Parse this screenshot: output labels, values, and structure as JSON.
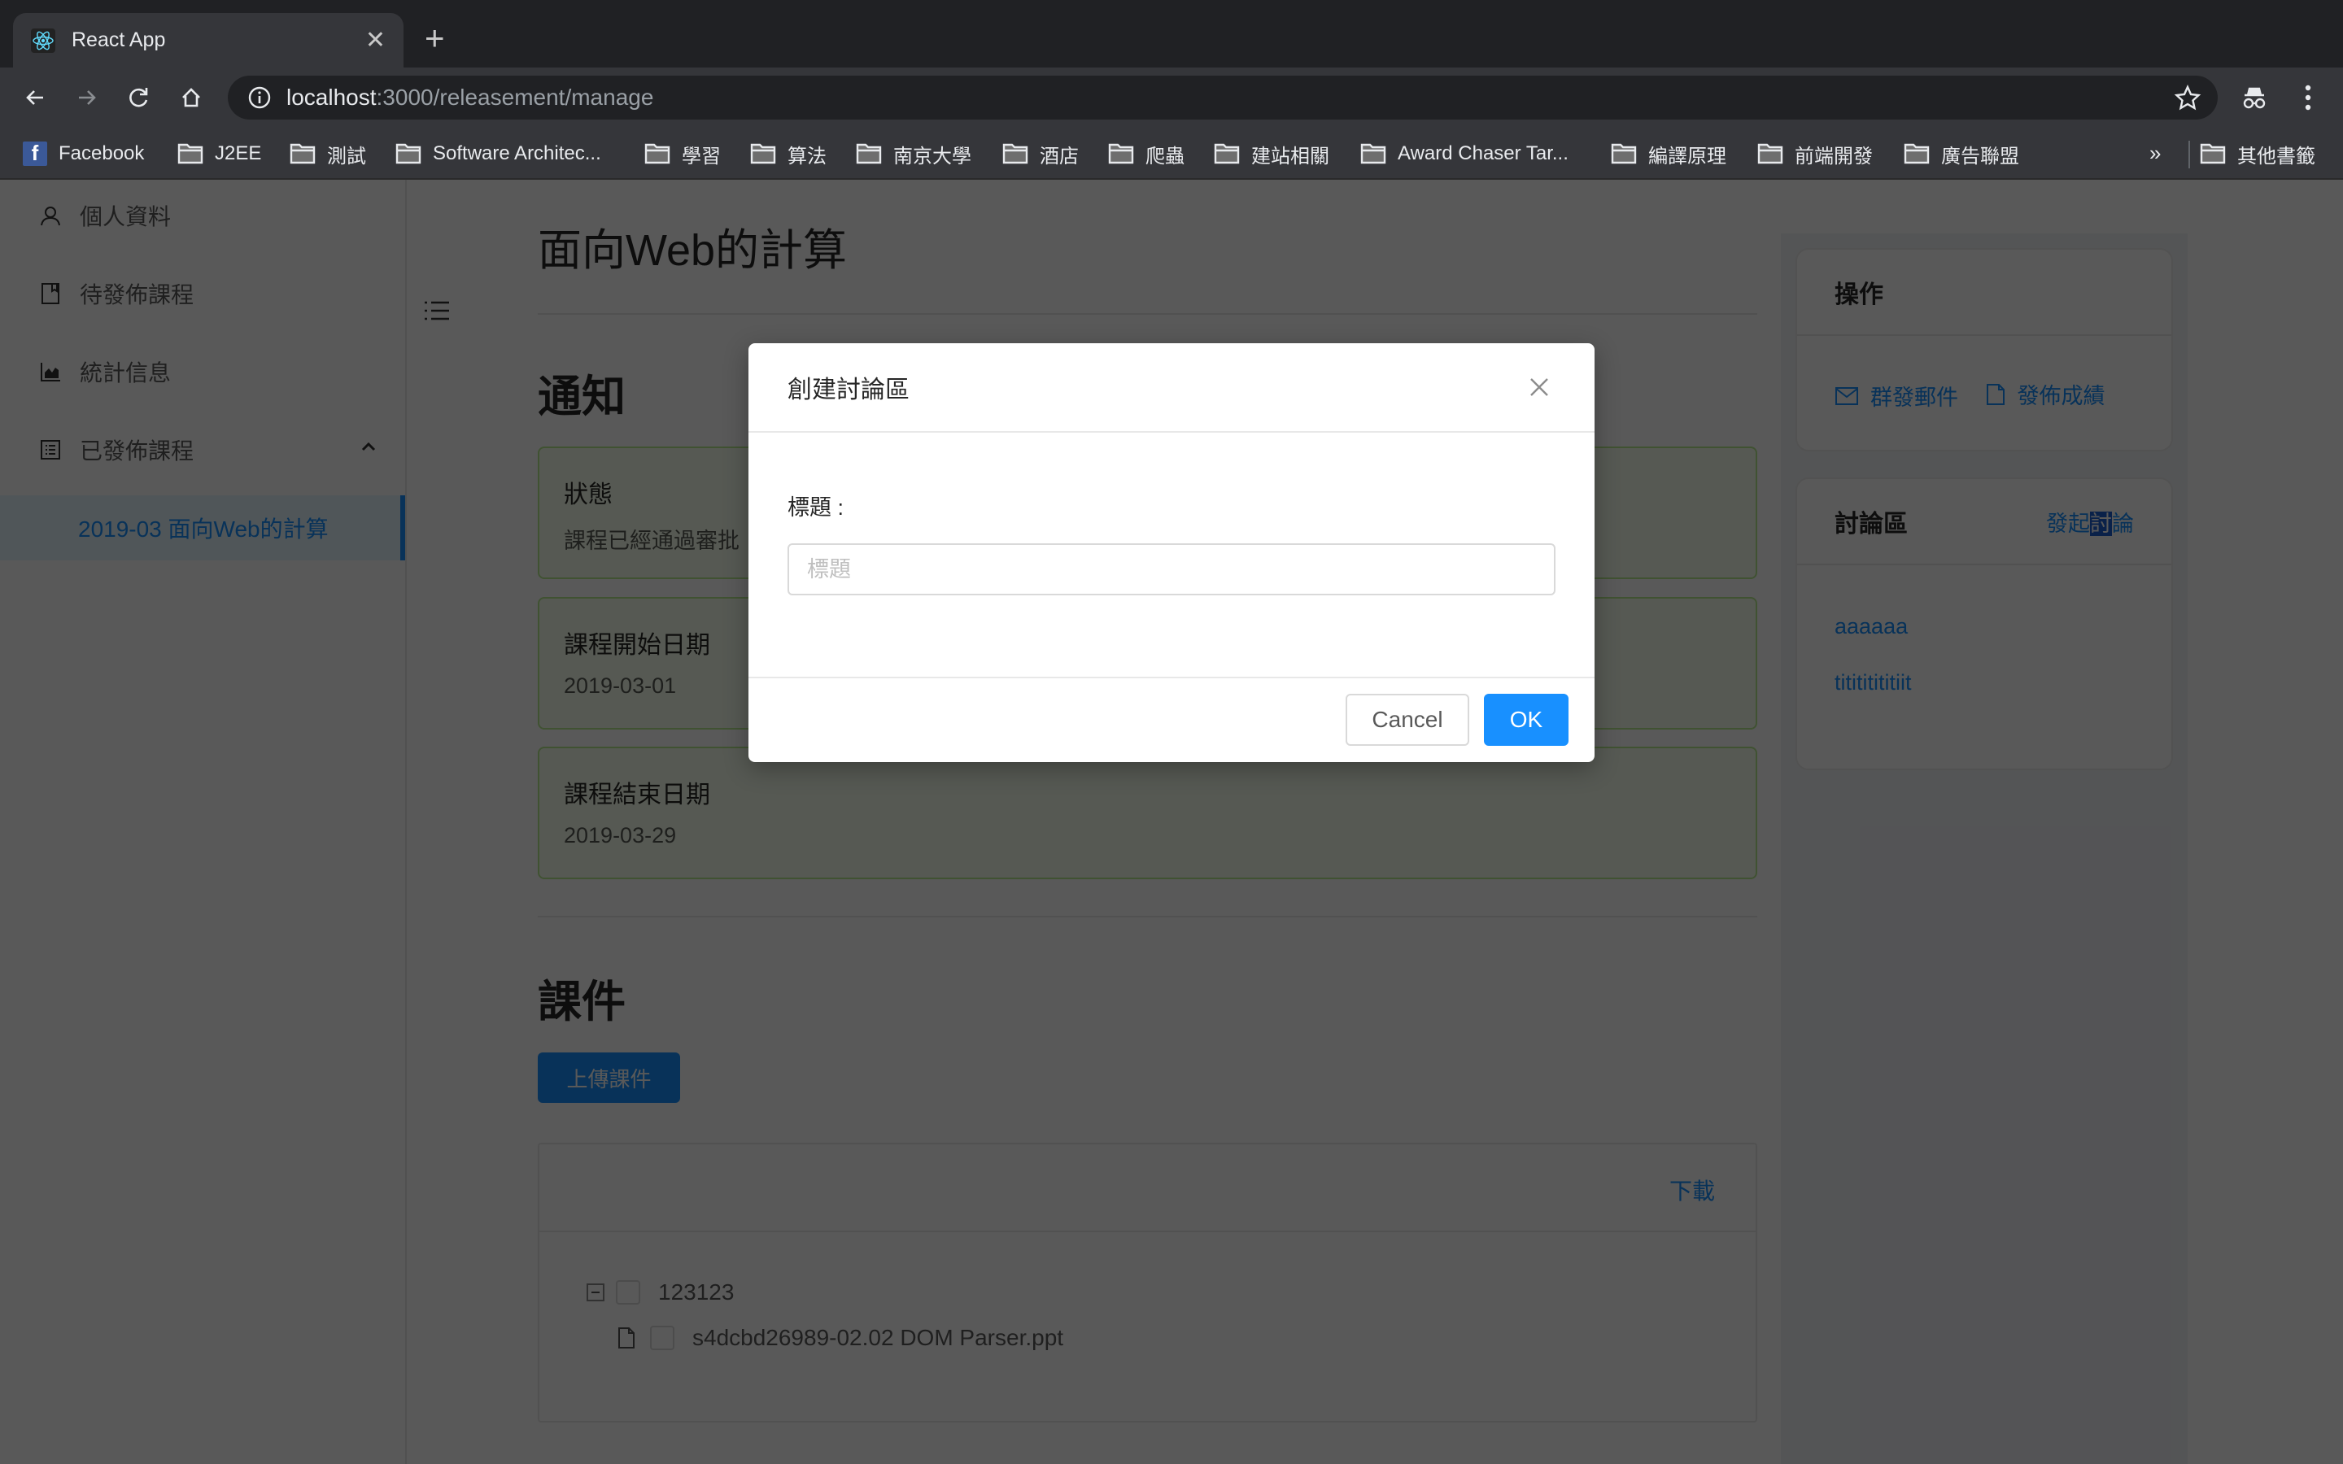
{
  "browser": {
    "tab_title": "React App",
    "url_host": "localhost",
    "url_path": ":3000/releasement/manage",
    "bookmarks": [
      {
        "label": "Facebook",
        "icon": "facebook-icon"
      },
      {
        "label": "J2EE",
        "icon": "folder-icon"
      },
      {
        "label": "測試",
        "icon": "folder-icon"
      },
      {
        "label": "Software Architec...",
        "icon": "folder-icon"
      },
      {
        "label": "學習",
        "icon": "folder-icon"
      },
      {
        "label": "算法",
        "icon": "folder-icon"
      },
      {
        "label": "南京大學",
        "icon": "folder-icon"
      },
      {
        "label": "酒店",
        "icon": "folder-icon"
      },
      {
        "label": "爬蟲",
        "icon": "folder-icon"
      },
      {
        "label": "建站相關",
        "icon": "folder-icon"
      },
      {
        "label": "Award Chaser Tar...",
        "icon": "folder-icon"
      },
      {
        "label": "編譯原理",
        "icon": "folder-icon"
      },
      {
        "label": "前端開發",
        "icon": "folder-icon"
      },
      {
        "label": "廣告聯盟",
        "icon": "folder-icon"
      }
    ],
    "bookmarks_overflow": "»",
    "other_bookmarks": "其他書籤"
  },
  "sidebar": {
    "items": [
      {
        "label": "個人資料",
        "icon": "user-icon"
      },
      {
        "label": "待發佈課程",
        "icon": "book-icon"
      },
      {
        "label": "統計信息",
        "icon": "area-chart-icon"
      },
      {
        "label": "已發佈課程",
        "icon": "profile-icon",
        "expanded": true
      }
    ],
    "sub_items": [
      {
        "label": "2019-03 面向Web的計算",
        "selected": true
      }
    ]
  },
  "main": {
    "title": "面向Web的計算",
    "notice_section": "通知",
    "alerts": [
      {
        "title": "狀態",
        "desc": "課程已經通過審批"
      },
      {
        "title": "課程開始日期",
        "desc": "2019-03-01"
      },
      {
        "title": "課程結束日期",
        "desc": "2019-03-29"
      }
    ],
    "courseware_section": "課件",
    "upload_button": "上傳課件",
    "download_link": "下載",
    "tree": {
      "folder": "123123",
      "file": "s4dcbd26989-02.02 DOM Parser.ppt"
    }
  },
  "right": {
    "actions_title": "操作",
    "actions": [
      {
        "label": "群發郵件",
        "icon": "mail-icon"
      },
      {
        "label": "發佈成績",
        "icon": "file-icon"
      }
    ],
    "discussion_title": "討論區",
    "discussion_extra_parts": [
      "發起",
      "討",
      "論"
    ],
    "discussions": [
      "aaaaaa",
      "titititititiit"
    ]
  },
  "modal": {
    "title": "創建討論區",
    "field_label": "標題 :",
    "field_placeholder": "標題",
    "field_value": "",
    "cancel": "Cancel",
    "ok": "OK"
  },
  "colors": {
    "primary": "#1890ff",
    "success_bg": "#f6ffed",
    "success_border": "#b7eb8f",
    "mask": "rgba(0,0,0,0.65)"
  }
}
